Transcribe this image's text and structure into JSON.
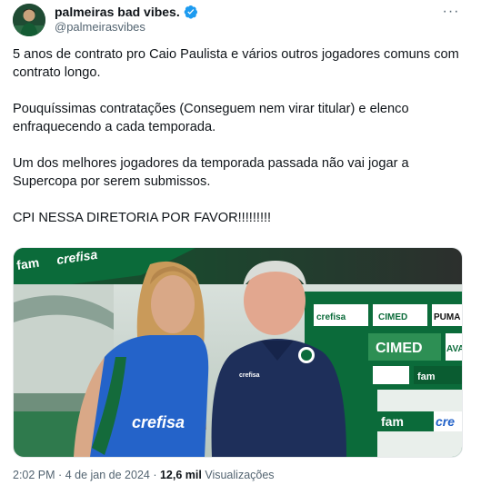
{
  "author": {
    "display_name": "palmeiras bad vibes.",
    "handle": "@palmeirasvibes",
    "verified": true,
    "avatar_icon": "player-avatar-icon"
  },
  "menu": {
    "icon": "more-horizontal-icon",
    "label": "···"
  },
  "body": {
    "paragraphs": [
      "5 anos de contrato pro Caio Paulista e vários outros jogadores comuns com contrato longo.",
      "Pouquíssimas contratações (Conseguem nem virar titular) e elenco enfraquecendo a cada temporada.",
      "Um dos melhores jogadores da temporada passada não vai jogar a Supercopa por serem submissos.",
      "CPI NESSA DIRETORIA POR FAVOR!!!!!!!!!"
    ]
  },
  "media": {
    "kind": "photo",
    "sign_text": {
      "fam_left": "fam",
      "crefisa": "crefisa",
      "cimed": "CIMED",
      "puma": "PUMA",
      "ava": "AVA",
      "fam_right": "fam",
      "cre_right": "cre",
      "shirt_sponsor": "crefisa",
      "shirt_brand": "crefisa\nfam"
    }
  },
  "meta": {
    "time": "2:02 PM",
    "separator": "·",
    "date": "4 de jan de 2024",
    "views_count": "12,6 mil",
    "views_label": "Visualizações"
  },
  "colors": {
    "palmeiras_green": "#0b6b3a",
    "verified_blue": "#1d9bf0",
    "shirt_blue": "#2463c9",
    "polo_navy": "#1e2f5a"
  }
}
